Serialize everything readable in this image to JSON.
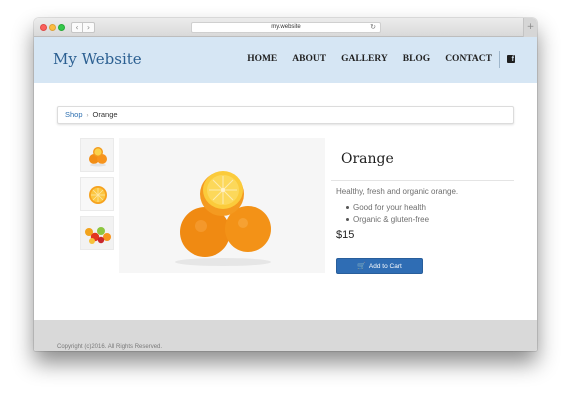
{
  "browser": {
    "url": "my.website",
    "back_glyph": "‹",
    "forward_glyph": "›",
    "new_tab_glyph": "+",
    "reload_glyph": "↻"
  },
  "header": {
    "logo": "My Website",
    "nav": [
      "HOME",
      "ABOUT",
      "GALLERY",
      "BLOG",
      "CONTACT"
    ],
    "social_icon": "facebook-icon",
    "background": "#d6e6f4"
  },
  "breadcrumb": {
    "link": "Shop",
    "separator": "›",
    "current": "Orange"
  },
  "product": {
    "title": "Orange",
    "description": "Healthy, fresh and organic orange.",
    "features": [
      "Good for your health",
      "Organic & gluten-free"
    ],
    "price": "$15",
    "cart_button": "Add to Cart",
    "thumbnails": [
      "oranges-pile-thumbnail",
      "orange-slice-thumbnail",
      "mixed-fruit-thumbnail"
    ],
    "accent": "#2f6db4"
  },
  "footer": {
    "copyright": "Copyright (c)2016. All Rights Reserved."
  }
}
